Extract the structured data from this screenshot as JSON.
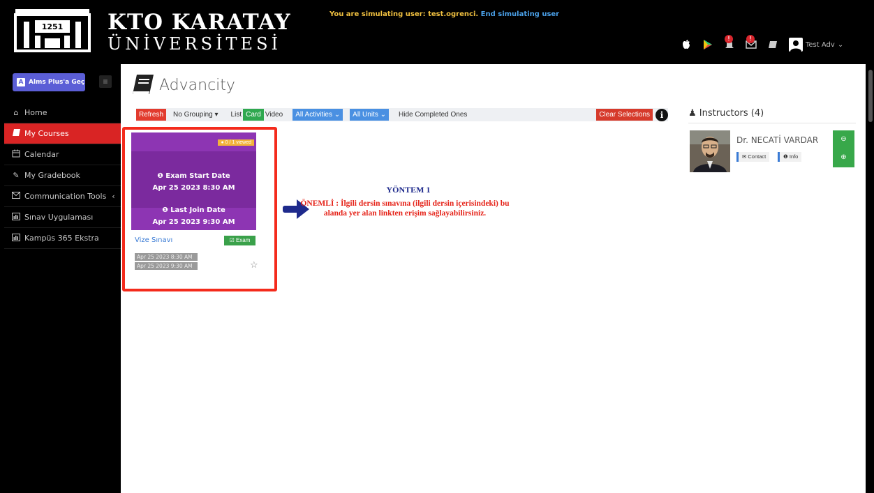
{
  "header": {
    "brand_line1": "KTO KARATAY",
    "brand_line2": "ÜNİVERSİTESİ",
    "logo_text": "1251",
    "simulating_text": "You are simulating user: test.ogrenci.",
    "end_simulating_label": "End simulating user",
    "notification_badge": "!",
    "messages_badge": "!",
    "user_name": "Test Adv"
  },
  "sidebar": {
    "alms_button_label": "Alms Plus'a Geç",
    "items": [
      {
        "label": "Home",
        "icon": "home-icon"
      },
      {
        "label": "My Courses",
        "icon": "book-icon"
      },
      {
        "label": "Calendar",
        "icon": "calendar-icon"
      },
      {
        "label": "My Gradebook",
        "icon": "pencil-icon"
      },
      {
        "label": "Communication Tools",
        "icon": "envelope-icon"
      },
      {
        "label": "Sınav Uygulaması",
        "icon": "chart-icon"
      },
      {
        "label": "Kampüs 365 Ekstra",
        "icon": "chart-icon"
      }
    ]
  },
  "main": {
    "title": "Advancity",
    "toolbar": {
      "refresh": "Refresh",
      "grouping": "No Grouping",
      "list": "List",
      "card": "Card",
      "video": "Video",
      "activities": "All Activities",
      "units": "All Units",
      "hide_completed": "Hide Completed Ones",
      "clear_selections": "Clear Selections"
    },
    "card": {
      "viewed": "0 / 1 viewed",
      "exam_start_label": "Exam Start Date",
      "exam_start_value": "Apr 25 2023 8:30 AM",
      "last_join_label": "Last Join Date",
      "last_join_value": "Apr 25 2023 9:30 AM",
      "title": "Vize Sınavı",
      "type": "Exam",
      "date1": "Apr 25 2023 8:30 AM",
      "date2": "Apr 25 2023 9:30 AM"
    },
    "annotation": {
      "title": "YÖNTEM 1",
      "body": "ÖNEMLİ : İlgili dersin sınavına (ilgili dersin içerisindeki) bu alanda yer alan linkten erişim sağlayabilirsiniz."
    }
  },
  "instructors": {
    "heading": "Instructors (4)",
    "name": "Dr. NECATİ VARDAR",
    "contact": "Contact",
    "info": "Info"
  },
  "colors": {
    "accent_red": "#d92424",
    "card_purple": "#7b2a9e",
    "green": "#2fa84f",
    "blue": "#4a90e2"
  }
}
